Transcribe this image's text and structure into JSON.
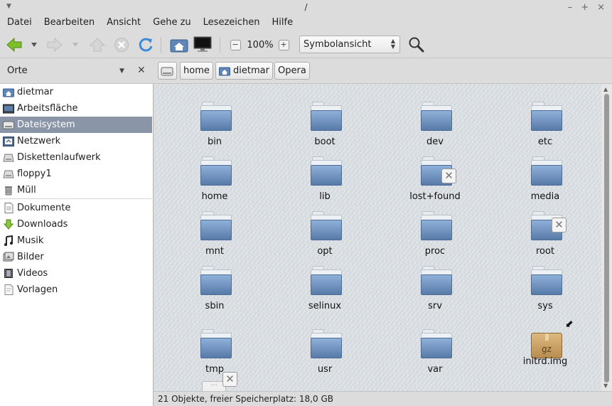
{
  "window": {
    "title": "/"
  },
  "menubar": [
    "Datei",
    "Bearbeiten",
    "Ansicht",
    "Gehe zu",
    "Lesezeichen",
    "Hilfe"
  ],
  "toolbar": {
    "zoom_level": "100%",
    "view_mode": "Symbolansicht"
  },
  "sidebar": {
    "header": "Orte",
    "items": [
      {
        "label": "dietmar",
        "icon": "home-folder-icon"
      },
      {
        "label": "Arbeitsfläche",
        "icon": "desktop-icon"
      },
      {
        "label": "Dateisystem",
        "icon": "harddisk-icon",
        "selected": true
      },
      {
        "label": "Netzwerk",
        "icon": "network-icon"
      },
      {
        "label": "Diskettenlaufwerk",
        "icon": "floppy-drive-icon"
      },
      {
        "label": "floppy1",
        "icon": "floppy-drive-icon"
      },
      {
        "label": "Müll",
        "icon": "trash-icon"
      },
      {
        "label": "Dokumente",
        "icon": "documents-icon"
      },
      {
        "label": "Downloads",
        "icon": "downloads-icon"
      },
      {
        "label": "Musik",
        "icon": "music-icon"
      },
      {
        "label": "Bilder",
        "icon": "pictures-icon"
      },
      {
        "label": "Videos",
        "icon": "videos-icon"
      },
      {
        "label": "Vorlagen",
        "icon": "templates-icon"
      }
    ]
  },
  "pathbar": [
    "home",
    "dietmar",
    "Opera"
  ],
  "files": [
    {
      "name": "bin",
      "type": "folder"
    },
    {
      "name": "boot",
      "type": "folder"
    },
    {
      "name": "dev",
      "type": "folder"
    },
    {
      "name": "etc",
      "type": "folder"
    },
    {
      "name": "home",
      "type": "folder"
    },
    {
      "name": "lib",
      "type": "folder"
    },
    {
      "name": "lost+found",
      "type": "folder",
      "emblem": "unreadable"
    },
    {
      "name": "media",
      "type": "folder"
    },
    {
      "name": "mnt",
      "type": "folder"
    },
    {
      "name": "opt",
      "type": "folder"
    },
    {
      "name": "proc",
      "type": "folder"
    },
    {
      "name": "root",
      "type": "folder",
      "emblem": "unreadable"
    },
    {
      "name": "sbin",
      "type": "folder"
    },
    {
      "name": "selinux",
      "type": "folder"
    },
    {
      "name": "srv",
      "type": "folder"
    },
    {
      "name": "sys",
      "type": "folder"
    },
    {
      "name": "tmp",
      "type": "folder"
    },
    {
      "name": "usr",
      "type": "folder"
    },
    {
      "name": "var",
      "type": "folder"
    },
    {
      "name": "initrd.img",
      "type": "archive",
      "badge": "gz",
      "emblem": "symlink"
    }
  ],
  "statusbar": {
    "text": "21 Objekte, freier Speicherplatz: 18,0 GB"
  }
}
